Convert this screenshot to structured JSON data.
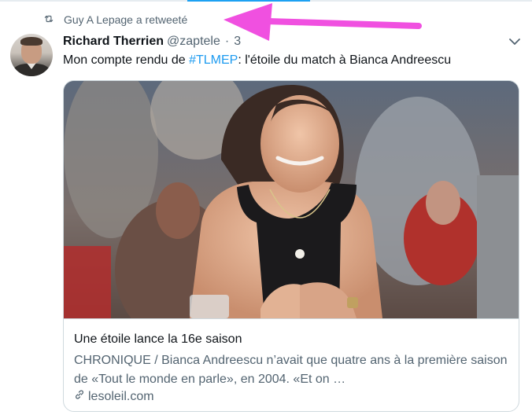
{
  "retweet": {
    "icon": "retweet-icon",
    "label": "Guy A Lepage a retweeté"
  },
  "tweet": {
    "avatar_icon": "avatar",
    "author_name": "Richard Therrien",
    "handle": "@zaptele",
    "separator": "·",
    "time": "3",
    "caret_icon": "chevron-down-icon",
    "text_before": "Mon compte rendu de ",
    "hashtag": "#TLMEP",
    "text_after": ": l'étoile du match à Bianca Andreescu"
  },
  "card": {
    "image_icon": "article-photo",
    "title": "Une étoile lance la 16e saison",
    "description": "CHRONIQUE / Bianca Andreescu n’avait que quatre ans à la première saison de «Tout le monde en parle», en 2004. «Et on …",
    "link_icon": "link-icon",
    "domain": "lesoleil.com"
  },
  "colors": {
    "accent": "#1d9bf0",
    "annotation_arrow": "#f050e0",
    "secondary_text": "#536471"
  }
}
